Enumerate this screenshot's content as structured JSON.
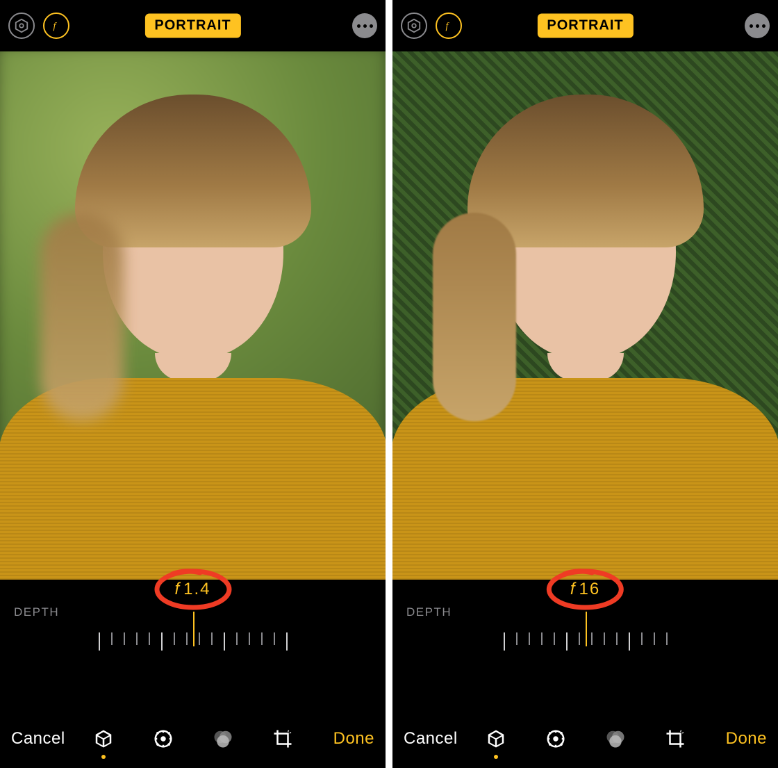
{
  "mode_badge": "PORTRAIT",
  "depth_label": "DEPTH",
  "cancel_label": "Cancel",
  "done_label": "Done",
  "panels": [
    {
      "f_value": "1.4",
      "blurry": true,
      "marker_offset_px": 0
    },
    {
      "f_value": "16",
      "blurry": false,
      "marker_offset_px": 0
    }
  ],
  "toolbar": {
    "tools": [
      {
        "name": "cube-icon",
        "active": true
      },
      {
        "name": "adjust-icon",
        "active": false
      },
      {
        "name": "filters-icon",
        "active": false
      },
      {
        "name": "crop-icon",
        "active": false
      }
    ]
  },
  "ticks": {
    "count_left": 16,
    "count_right": 14,
    "majors_every": 5
  }
}
